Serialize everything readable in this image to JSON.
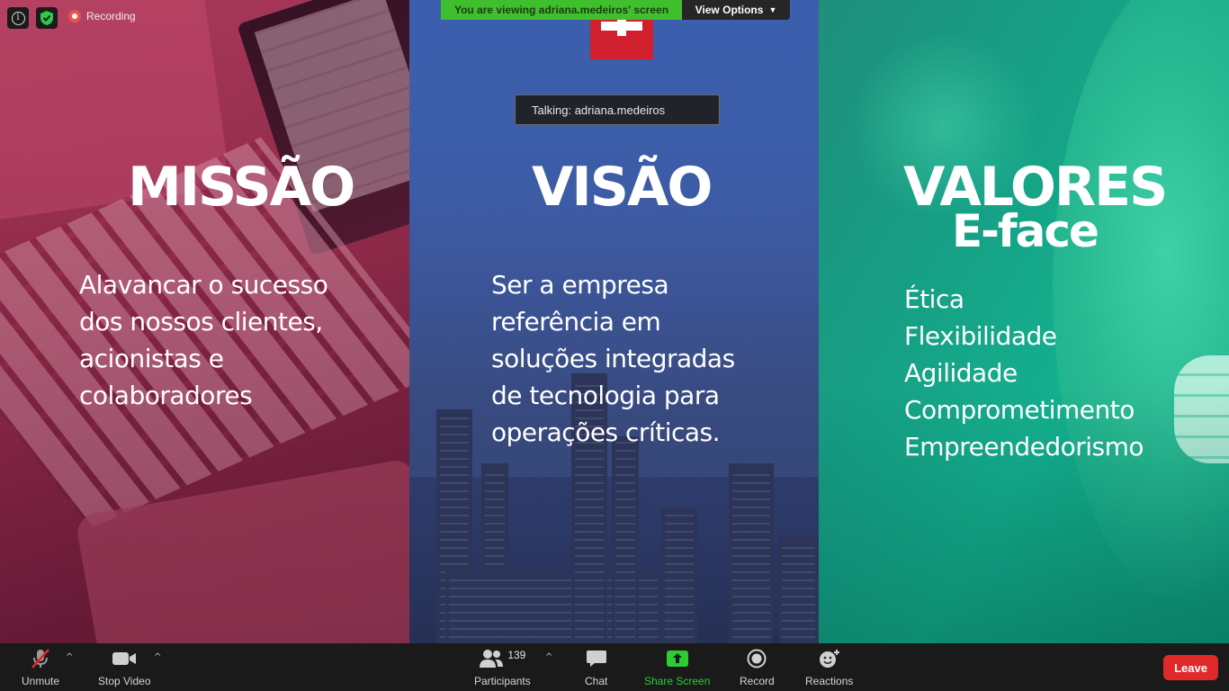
{
  "top_left": {
    "recording_label": "Recording"
  },
  "banner": {
    "viewing_text": "You are viewing adriana.medeiros' screen",
    "view_options_label": "View Options"
  },
  "tooltip": {
    "talking_text": "Talking: adriana.medeiros"
  },
  "slide": {
    "missao": {
      "title": "MISSÃO",
      "lines": [
        "Alavancar o sucesso",
        "dos nossos clientes,",
        "acionistas e",
        "colaboradores"
      ]
    },
    "visao": {
      "title": "VISÃO",
      "lines": [
        "Ser a empresa",
        "referência em",
        "soluções integradas",
        "de tecnologia para",
        "operações críticas."
      ]
    },
    "valores": {
      "title": "VALORES",
      "subtitle": "E-face",
      "lines": [
        "Ética",
        "Flexibilidade",
        "Agilidade",
        "Comprometimento",
        "Empreendedorismo"
      ]
    },
    "colors": {
      "missao": "#9d3251",
      "visao": "#3d5ca6",
      "valores": "#16a085"
    }
  },
  "toolbar": {
    "unmute_label": "Unmute",
    "stop_video_label": "Stop Video",
    "participants_label": "Participants",
    "participants_count": "139",
    "chat_label": "Chat",
    "share_screen_label": "Share Screen",
    "record_label": "Record",
    "reactions_label": "Reactions",
    "leave_label": "Leave",
    "colors": {
      "share": "#2dcc35",
      "leave": "#e02a2a"
    }
  }
}
